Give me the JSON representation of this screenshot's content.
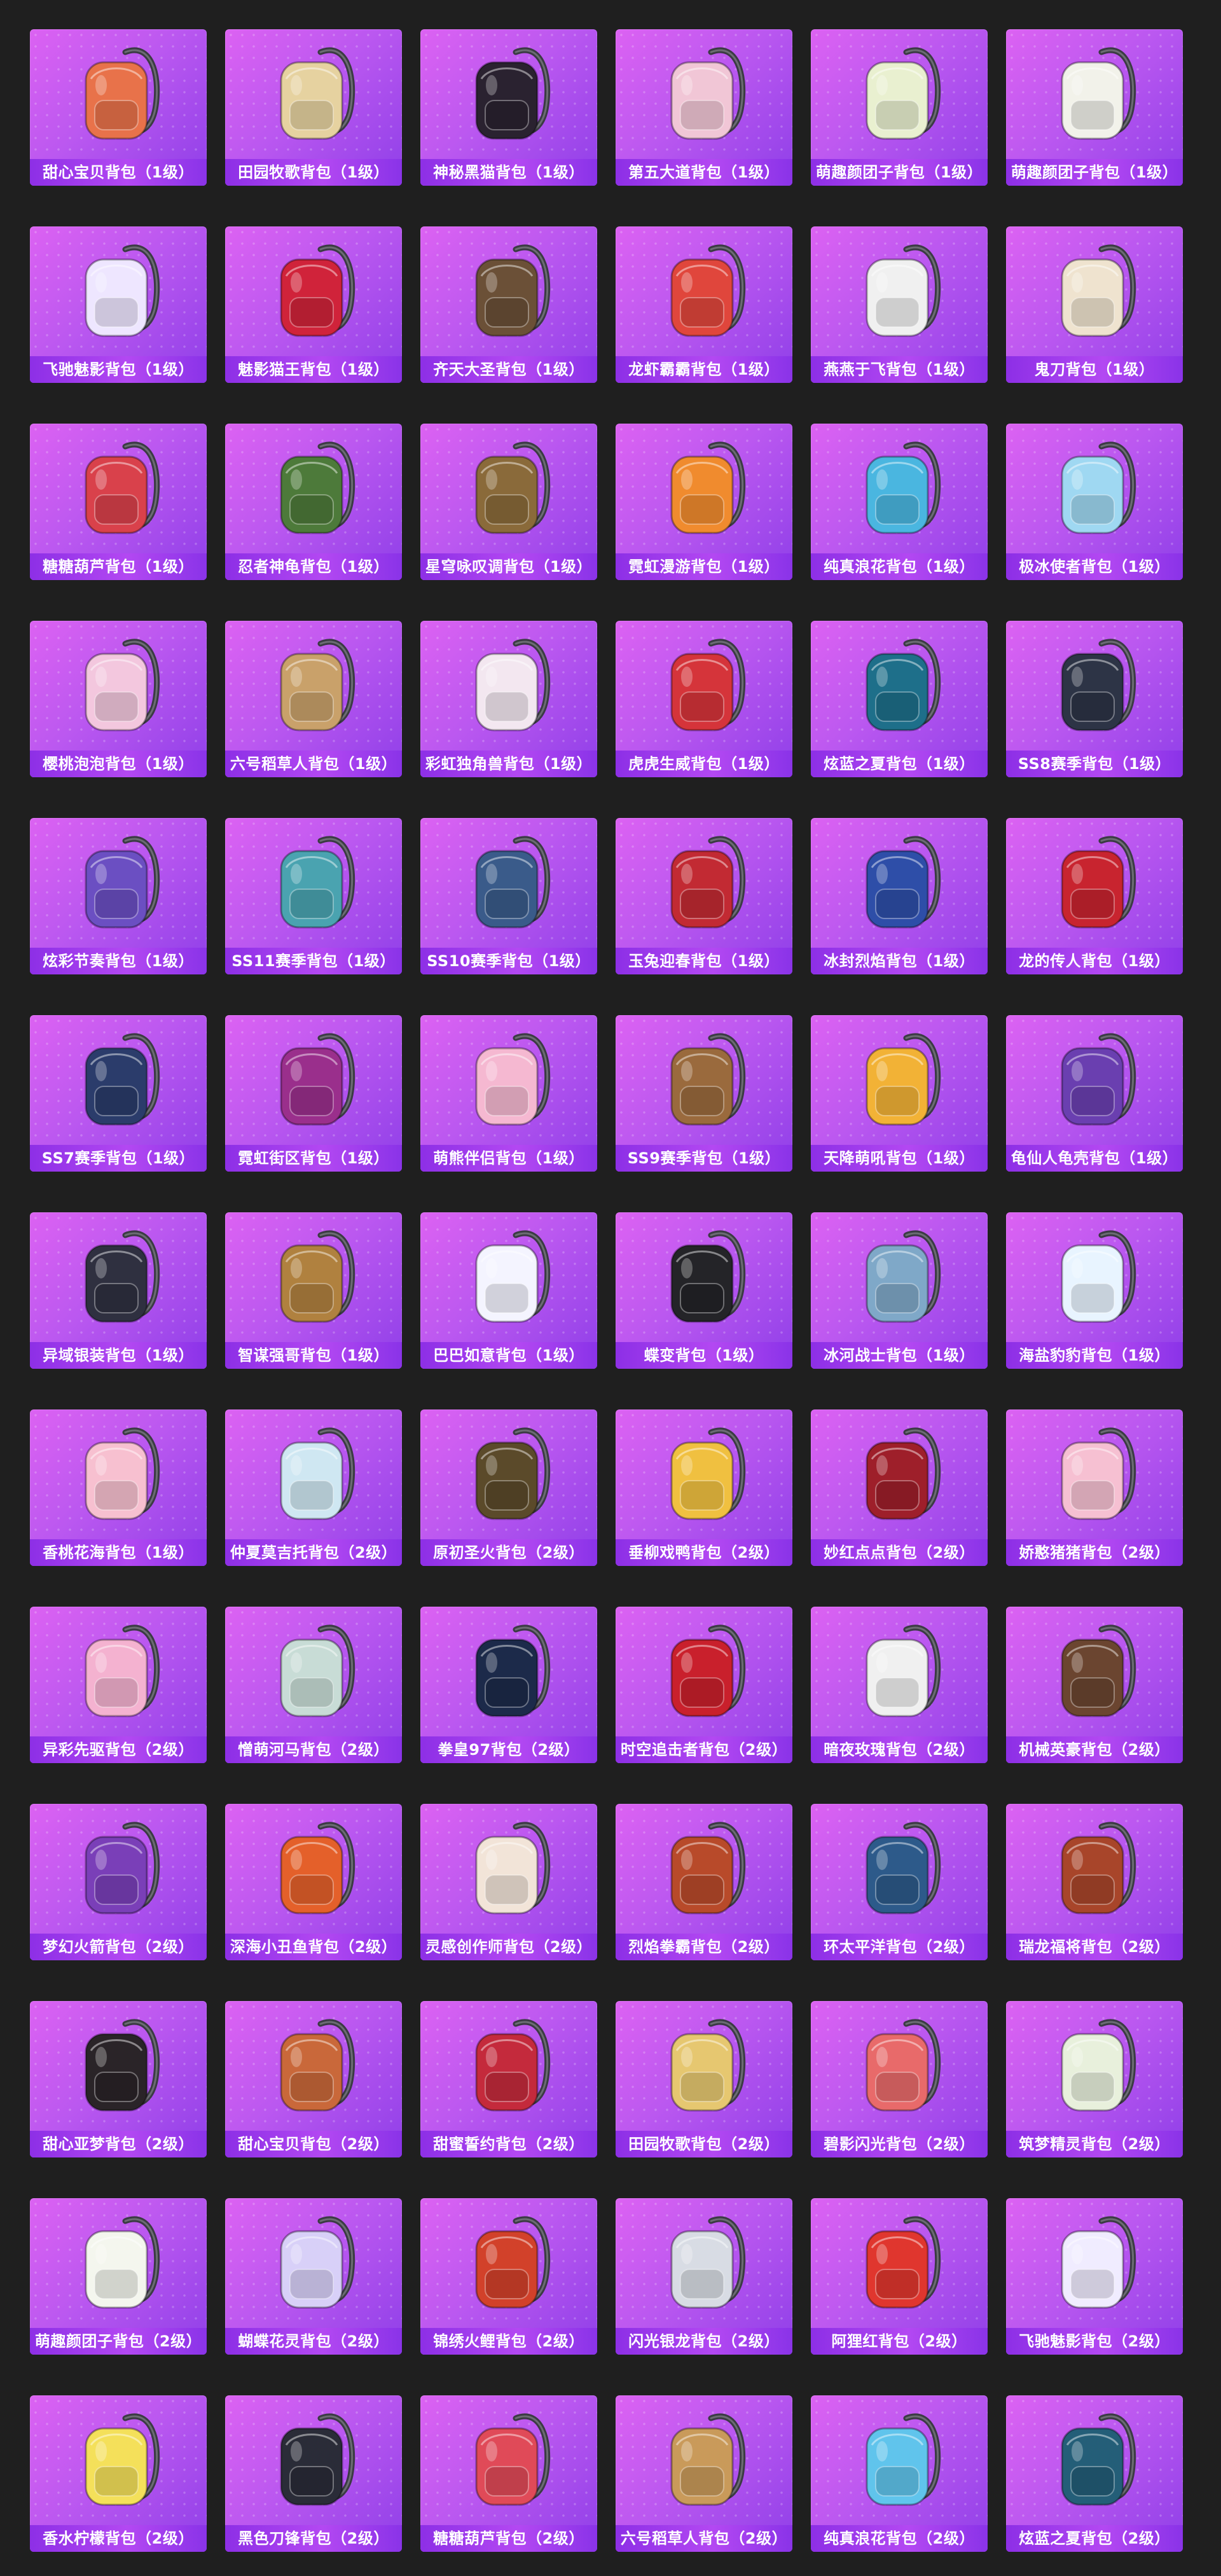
{
  "items": [
    {
      "name": "甜心宝贝背包（1级）",
      "color": "#e8724a"
    },
    {
      "name": "田园牧歌背包（1级）",
      "color": "#e6d2a0"
    },
    {
      "name": "神秘黑猫背包（1级）",
      "color": "#2a2230"
    },
    {
      "name": "第五大道背包（1级）",
      "color": "#f1c6d6"
    },
    {
      "name": "萌趣颜团子背包（1级）",
      "color": "#e9f0d0"
    },
    {
      "name": "萌趣颜团子背包（1级）",
      "color": "#f2f2ea"
    },
    {
      "name": "飞驰魅影背包（1级）",
      "color": "#eee6ff"
    },
    {
      "name": "魅影猫王背包（1级）",
      "color": "#d0233a"
    },
    {
      "name": "齐天大圣背包（1级）",
      "color": "#6b5037"
    },
    {
      "name": "龙虾霸霸背包（1级）",
      "color": "#e0463c"
    },
    {
      "name": "燕燕于飞背包（1级）",
      "color": "#f0f0f0"
    },
    {
      "name": "鬼刀背包（1级）",
      "color": "#efe3cf"
    },
    {
      "name": "糖糖葫芦背包（1级）",
      "color": "#d9414b"
    },
    {
      "name": "忍者神龟背包（1级）",
      "color": "#4d7a3a"
    },
    {
      "name": "星穹咏叹调背包（1级）",
      "color": "#8a6a3a"
    },
    {
      "name": "霓虹漫游背包（1级）",
      "color": "#f08b2e"
    },
    {
      "name": "纯真浪花背包（1级）",
      "color": "#4ab6e0"
    },
    {
      "name": "极冰使者背包（1级）",
      "color": "#9fd8f2"
    },
    {
      "name": "樱桃泡泡背包（1级）",
      "color": "#f3c7de"
    },
    {
      "name": "六号稻草人背包（1级）",
      "color": "#c9a16a"
    },
    {
      "name": "彩虹独角兽背包（1级）",
      "color": "#f3e7f0"
    },
    {
      "name": "虎虎生威背包（1级）",
      "color": "#d5343a"
    },
    {
      "name": "炫蓝之夏背包（1级）",
      "color": "#1e6f8a"
    },
    {
      "name": "SS8赛季背包（1级）",
      "color": "#2d3446"
    },
    {
      "name": "炫彩节奏背包（1级）",
      "color": "#6b4fc2"
    },
    {
      "name": "SS11赛季背包（1级）",
      "color": "#4aa3b0"
    },
    {
      "name": "SS10赛季背包（1级）",
      "color": "#3a5b8a"
    },
    {
      "name": "玉兔迎春背包（1级）",
      "color": "#c22a33"
    },
    {
      "name": "冰封烈焰背包（1级）",
      "color": "#2e4ea8"
    },
    {
      "name": "龙的传人背包（1级）",
      "color": "#c8242f"
    },
    {
      "name": "SS7赛季背包（1级）",
      "color": "#2b3c6b"
    },
    {
      "name": "霓虹街区背包（1级）",
      "color": "#9a2f8c"
    },
    {
      "name": "萌熊伴侣背包（1级）",
      "color": "#f5b8d1"
    },
    {
      "name": "SS9赛季背包（1级）",
      "color": "#9a6a3d"
    },
    {
      "name": "天降萌吼背包（1级）",
      "color": "#f2b236"
    },
    {
      "name": "龟仙人龟壳背包（1级）",
      "color": "#6a3fb0"
    },
    {
      "name": "异域银装背包（1级）",
      "color": "#2f3040"
    },
    {
      "name": "智谋强哥背包（1级）",
      "color": "#b0813f"
    },
    {
      "name": "巴巴如意背包（1级）",
      "color": "#f4f4ff"
    },
    {
      "name": "蝶变背包（1级）",
      "color": "#242428"
    },
    {
      "name": "冰河战士背包（1级）",
      "color": "#7fa8c8"
    },
    {
      "name": "海盐豹豹背包（1级）",
      "color": "#e8f4ff"
    },
    {
      "name": "香桃花海背包（1级）",
      "color": "#f7c0d0"
    },
    {
      "name": "仲夏莫吉托背包（2级）",
      "color": "#cfe7f2"
    },
    {
      "name": "原初圣火背包（2级）",
      "color": "#5b4a2a"
    },
    {
      "name": "垂柳戏鸭背包（2级）",
      "color": "#f0c040"
    },
    {
      "name": "妙红点点背包（2级）",
      "color": "#9e1f2a"
    },
    {
      "name": "娇憨猪猪背包（2级）",
      "color": "#f6c0d2"
    },
    {
      "name": "异彩先驱背包（2级）",
      "color": "#f4b2d0"
    },
    {
      "name": "憎萌河马背包（2级）",
      "color": "#c8dcd6"
    },
    {
      "name": "拳皇97背包（2级）",
      "color": "#1c2a4a"
    },
    {
      "name": "时空追击者背包（2级）",
      "color": "#c9202c"
    },
    {
      "name": "暗夜玫瑰背包（2级）",
      "color": "#f0f0f0"
    },
    {
      "name": "机械英豪背包（2级）",
      "color": "#6b4530"
    },
    {
      "name": "梦幻火箭背包（2级）",
      "color": "#7a3fb8"
    },
    {
      "name": "深海小丑鱼背包（2级）",
      "color": "#e4602a"
    },
    {
      "name": "灵感创作师背包（2级）",
      "color": "#f2e4d8"
    },
    {
      "name": "烈焰拳霸背包（2级）",
      "color": "#b84a2a"
    },
    {
      "name": "环太平洋背包（2级）",
      "color": "#2d5a8a"
    },
    {
      "name": "瑞龙福将背包（2级）",
      "color": "#a8452a"
    },
    {
      "name": "甜心亚梦背包（2级）",
      "color": "#2a2428"
    },
    {
      "name": "甜心宝贝背包（2级）",
      "color": "#c9683a"
    },
    {
      "name": "甜蜜誓约背包（2级）",
      "color": "#c42a3c"
    },
    {
      "name": "田园牧歌背包（2级）",
      "color": "#e6c770"
    },
    {
      "name": "碧影闪光背包（2级）",
      "color": "#e86a6a"
    },
    {
      "name": "筑梦精灵背包（2级）",
      "color": "#e8f0dc"
    },
    {
      "name": "萌趣颜团子背包（2级）",
      "color": "#f4f6ee"
    },
    {
      "name": "蝴蝶花灵背包（2级）",
      "color": "#d8d0f8"
    },
    {
      "name": "锦绣火鲤背包（2级）",
      "color": "#d2412a"
    },
    {
      "name": "闪光银龙背包（2级）",
      "color": "#d8dce4"
    },
    {
      "name": "阿狸红背包（2级）",
      "color": "#e0362e"
    },
    {
      "name": "飞驰魅影背包（2级）",
      "color": "#f0ecff"
    },
    {
      "name": "香水柠檬背包（2级）",
      "color": "#f4e05a"
    },
    {
      "name": "黑色刀锋背包（2级）",
      "color": "#2a2c38"
    },
    {
      "name": "糖糖葫芦背包（2级）",
      "color": "#e04a58"
    },
    {
      "name": "六号稻草人背包（2级）",
      "color": "#c99a5a"
    },
    {
      "name": "纯真浪花背包（2级）",
      "color": "#60c4ec"
    },
    {
      "name": "炫蓝之夏背包（2级）",
      "color": "#245e78"
    }
  ]
}
